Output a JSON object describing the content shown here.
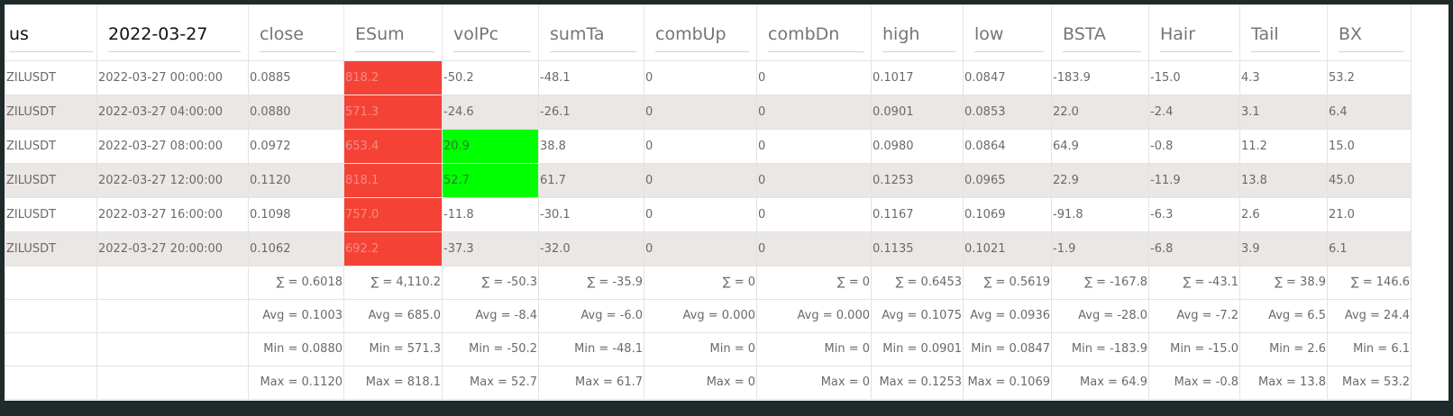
{
  "header": {
    "filter_values": [
      "us",
      "2022-03-27"
    ],
    "columns": [
      "close",
      "ESum",
      "volPc",
      "sumTa",
      "combUp",
      "combDn",
      "high",
      "low",
      "BSTA",
      "Hair",
      "Tail",
      "BX"
    ]
  },
  "rows": [
    [
      "ZILUSDT",
      "2022-03-27 00:00:00",
      "0.0885",
      "818.2",
      "-50.2",
      "-48.1",
      "0",
      "0",
      "0.1017",
      "0.0847",
      "-183.9",
      "-15.0",
      "4.3",
      "53.2"
    ],
    [
      "ZILUSDT",
      "2022-03-27 04:00:00",
      "0.0880",
      "571.3",
      "-24.6",
      "-26.1",
      "0",
      "0",
      "0.0901",
      "0.0853",
      "22.0",
      "-2.4",
      "3.1",
      "6.4"
    ],
    [
      "ZILUSDT",
      "2022-03-27 08:00:00",
      "0.0972",
      "653.4",
      "20.9",
      "38.8",
      "0",
      "0",
      "0.0980",
      "0.0864",
      "64.9",
      "-0.8",
      "11.2",
      "15.0"
    ],
    [
      "ZILUSDT",
      "2022-03-27 12:00:00",
      "0.1120",
      "818.1",
      "52.7",
      "61.7",
      "0",
      "0",
      "0.1253",
      "0.0965",
      "22.9",
      "-11.9",
      "13.8",
      "45.0"
    ],
    [
      "ZILUSDT",
      "2022-03-27 16:00:00",
      "0.1098",
      "757.0",
      "-11.8",
      "-30.1",
      "0",
      "0",
      "0.1167",
      "0.1069",
      "-91.8",
      "-6.3",
      "2.6",
      "21.0"
    ],
    [
      "ZILUSDT",
      "2022-03-27 20:00:00",
      "0.1062",
      "692.2",
      "-37.3",
      "-32.0",
      "0",
      "0",
      "0.1135",
      "0.1021",
      "-1.9",
      "-6.8",
      "3.9",
      "6.1"
    ]
  ],
  "cell_highlights": {
    "negative_color": "#f44336",
    "positive_color": "#00ff00",
    "ESum": [
      "neg",
      "neg",
      "neg",
      "neg",
      "neg",
      "neg"
    ],
    "volPc": [
      "",
      "",
      "pos",
      "pos",
      "",
      ""
    ]
  },
  "summary": {
    "sum": [
      "",
      "",
      "∑ = 0.6018",
      "∑ = 4,110.2",
      "∑ = -50.3",
      "∑ = -35.9",
      "∑ = 0",
      "∑ = 0",
      "∑ = 0.6453",
      "∑ = 0.5619",
      "∑ = -167.8",
      "∑ = -43.1",
      "∑ = 38.9",
      "∑ = 146.6"
    ],
    "avg": [
      "",
      "",
      "Avg = 0.1003",
      "Avg = 685.0",
      "Avg = -8.4",
      "Avg = -6.0",
      "Avg = 0.000",
      "Avg = 0.000",
      "Avg = 0.1075",
      "Avg = 0.0936",
      "Avg = -28.0",
      "Avg = -7.2",
      "Avg = 6.5",
      "Avg = 24.4"
    ],
    "min": [
      "",
      "",
      "Min = 0.0880",
      "Min = 571.3",
      "Min = -50.2",
      "Min = -48.1",
      "Min = 0",
      "Min = 0",
      "Min = 0.0901",
      "Min = 0.0847",
      "Min = -183.9",
      "Min = -15.0",
      "Min = 2.6",
      "Min = 6.1"
    ],
    "max": [
      "",
      "",
      "Max = 0.1120",
      "Max = 818.1",
      "Max = 52.7",
      "Max = 61.7",
      "Max = 0",
      "Max = 0",
      "Max = 0.1253",
      "Max = 0.1069",
      "Max = 64.9",
      "Max = -0.8",
      "Max = 13.8",
      "Max = 53.2"
    ]
  }
}
